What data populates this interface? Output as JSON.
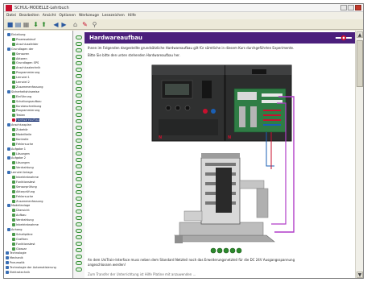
{
  "app": {
    "title": "SCHUL-MODELLE-Lehrbuch",
    "menu": [
      "Datei",
      "Bearbeiten",
      "Ansicht",
      "Optionen",
      "Werkzeuge",
      "Lesezeichen",
      "Hilfe"
    ]
  },
  "toolbar": {
    "icons": [
      "save-icon",
      "open-icon",
      "print-icon",
      "down-arrow-icon",
      "up-arrow-icon",
      "back-icon",
      "forward-icon",
      "home-icon",
      "tools-icon",
      "search-icon"
    ]
  },
  "tree": {
    "items": [
      {
        "label": "Einleitung",
        "icon": "book"
      },
      {
        "label": "Prozessablauf",
        "icon": "page"
      },
      {
        "label": "Anschlussfelder",
        "icon": "page"
      },
      {
        "label": "Grundlagen der",
        "icon": "book"
      },
      {
        "label": "Sensoren",
        "icon": "page"
      },
      {
        "label": "Aktoren",
        "icon": "page"
      },
      {
        "label": "Grundlagen SPS",
        "icon": "page"
      },
      {
        "label": "Anschlusstechnik",
        "icon": "page"
      },
      {
        "label": "Programmierung",
        "icon": "page"
      },
      {
        "label": "Lernziel 1",
        "icon": "page"
      },
      {
        "label": "Lernziel 2",
        "icon": "page"
      },
      {
        "label": "Zusammenfassung",
        "icon": "page"
      },
      {
        "label": "Sicherheitshinweise",
        "icon": "book"
      },
      {
        "label": "Einführung",
        "icon": "page"
      },
      {
        "label": "Schaltungsaufbau",
        "icon": "page"
      },
      {
        "label": "Kurzbeschreibung",
        "icon": "page"
      },
      {
        "label": "Programmierung",
        "icon": "page"
      },
      {
        "label": "Testen",
        "icon": "page"
      },
      {
        "label": "Hardwareaufbau",
        "icon": "sel"
      },
      {
        "label": "Anschlussplan",
        "icon": "book"
      },
      {
        "label": "Zubehör",
        "icon": "page"
      },
      {
        "label": "Modellteile",
        "icon": "page"
      },
      {
        "label": "Kontrolle",
        "icon": "page"
      },
      {
        "label": "Fehlersuche",
        "icon": "page"
      },
      {
        "label": "Aufgabe 1",
        "icon": "book"
      },
      {
        "label": "Lösungen",
        "icon": "page"
      },
      {
        "label": "Aufgabe 2",
        "icon": "book"
      },
      {
        "label": "Lösungen",
        "icon": "page"
      },
      {
        "label": "Verdrahtung",
        "icon": "page"
      },
      {
        "label": "Lernziel Anlage",
        "icon": "book"
      },
      {
        "label": "Inbetriebnahme",
        "icon": "page"
      },
      {
        "label": "Funktionstest",
        "icon": "page"
      },
      {
        "label": "Sensorprüfung",
        "icon": "page"
      },
      {
        "label": "Aktorprüfung",
        "icon": "page"
      },
      {
        "label": "Fehlersuche",
        "icon": "page"
      },
      {
        "label": "Zusammenfassung",
        "icon": "page"
      },
      {
        "label": "Modellanlage",
        "icon": "book"
      },
      {
        "label": "Übersicht",
        "icon": "page"
      },
      {
        "label": "Aufbau",
        "icon": "page"
      },
      {
        "label": "Verdrahtung",
        "icon": "page"
      },
      {
        "label": "Inbetriebnahme",
        "icon": "page"
      },
      {
        "label": "Anhang",
        "icon": "book"
      },
      {
        "label": "Schaltpläne",
        "icon": "page"
      },
      {
        "label": "Grafiken",
        "icon": "page"
      },
      {
        "label": "Funktionstest",
        "icon": "page"
      },
      {
        "label": "Glossar",
        "icon": "page"
      },
      {
        "label": "Technologie",
        "icon": "book"
      },
      {
        "label": "Mechanik",
        "icon": "book"
      },
      {
        "label": "Pneumatik",
        "icon": "book"
      },
      {
        "label": "Technologie der Automatisierung",
        "icon": "book"
      },
      {
        "label": "Elektrotechnik",
        "icon": "book"
      }
    ]
  },
  "page": {
    "heading": "Hardwareaufbau",
    "intro": "Ihnen im Folgenden dargestellte grundsätzliche Hardwareaufbau gilt für sämtliche in diesem Kurs durchgeführten Experimente.",
    "hint": "Bitte Sie bitte den unten stehenden Hardwareaufbau her.",
    "footer_line1": "An dem UniTrain-Interface muss neben dem Standard Netzteil noch das Erweiterungsnetzteil für die DC 24V Ausgangsspannung",
    "footer_line2": "angeschlossen werden!",
    "footer_line3": "Zum Transfer der Unterrichtung ist Hilfe Platine mit anzuwenden ..."
  },
  "nav": {
    "count": 5
  },
  "colors": {
    "header_bg": "#4b1f7c",
    "brand_red": "#c8102e",
    "ring_green": "#2d8a2d",
    "wire_magenta": "#b03cc8"
  }
}
